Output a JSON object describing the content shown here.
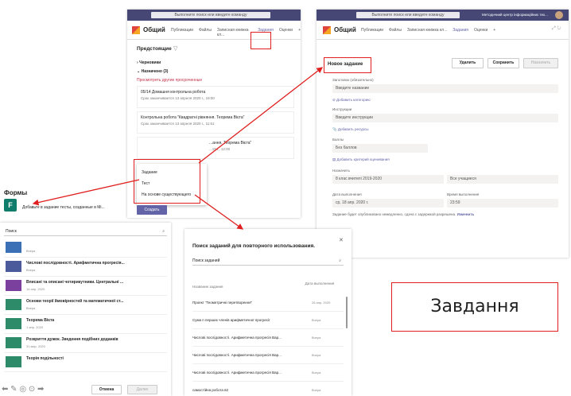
{
  "left_panel": {
    "search_placeholder": "Выполните поиск или введите команду",
    "channel": "Общий",
    "tabs": [
      "Публикации",
      "Файлы",
      "Записная книжка кл...",
      "Задания",
      "Оценки",
      "+"
    ],
    "upcoming": "Предстоящие",
    "drafts": "Черновики",
    "assigned": "Назначено (3)",
    "overdue_link": "Просмотреть другие просроченные",
    "cards": [
      {
        "title": "05/14 Домашня контрольна робота",
        "due": "Срок заканчивается 13 апреля 2020 г., 19:00"
      },
      {
        "title": "Контрольна робота \"Квадратні рівняння. Теорема Вієта\"",
        "due": "Срок заканчивается 13 апреля 2020 г., 11:51"
      },
      {
        "title": "...ання. Теорема Вієта\"",
        "due": "...19 г., 12:00"
      }
    ],
    "menu": [
      "Задание",
      "Тест",
      "На основе существующего"
    ],
    "create": "Создать"
  },
  "right_panel": {
    "search_placeholder": "Выполните поиск или введите команду",
    "org": "Методичний центр інформаційних тех...",
    "channel": "Общий",
    "tabs": [
      "Публикации",
      "Файлы",
      "Записная книжка кл...",
      "Задания",
      "Оценки",
      "+"
    ],
    "new_assignment": "Новое задание",
    "delete": "Удалить",
    "save": "Сохранить",
    "assign": "Назначить",
    "title_label": "Заголовок (обязательно)",
    "title_placeholder": "Введите название",
    "add_category": "Добавить категорию",
    "instructions_label": "Инструкции",
    "instructions_placeholder": "Введите инструкции",
    "add_resources": "Добавить ресурсы",
    "points_label": "Баллы",
    "points_value": "Без баллов",
    "add_rubric": "Добавить критерий оценивания",
    "assign_to_label": "Назначить",
    "class_value": "8 клас вчителі 2019-2020",
    "students_value": "Все учащиеся",
    "due_date_label": "Дата выполнения",
    "due_time_label": "Время выполнения",
    "due_date_value": "ср, 18 апр. 2020 г.",
    "due_time_value": "23:59",
    "note": "Задание будет опубликовано немедленно, сдача с задержкой разрешена.",
    "change_link": "Изменить"
  },
  "forms_panel": {
    "title": "Формы",
    "description": "Добавьте в задание тесты, созданные в Mi...",
    "search_placeholder": "Поиск",
    "items": [
      {
        "title": "",
        "date": "Вчера",
        "color": "#3b6fb6"
      },
      {
        "title": "Числові послідовності. Арифметична прогресія...",
        "date": "Вчера",
        "color": "#4a5a9a"
      },
      {
        "title": "Вписані та описані чотирикутники. Центральні ...",
        "date": "14 апр. 2020",
        "color": "#7b3f9e"
      },
      {
        "title": "Основи теорії ймовірностей та математичної ст...",
        "date": "Вчера",
        "color": "#2e8b6a"
      },
      {
        "title": "Теорема Вієта",
        "date": "1 апр. 2020",
        "color": "#2e8b6a"
      },
      {
        "title": "Розкриття дужок. Зведення подібних доданків",
        "date": "31 мар. 2020",
        "color": "#2e8b6a"
      },
      {
        "title": "Теорія подільності",
        "date": "",
        "color": "#2e8b6a"
      }
    ],
    "cancel": "Отмена",
    "next": "Далее"
  },
  "reuse_dialog": {
    "title": "Поиск заданий для повторного использования.",
    "search_placeholder": "Поиск заданий",
    "col_name": "Название задания",
    "col_date": "Дата выполнения",
    "rows": [
      {
        "name": "Проект \"Геометричні перетворення\"",
        "date": "26 апр. 2020"
      },
      {
        "name": "Сума n перших членів арифметичної прогресії",
        "date": "Вчера"
      },
      {
        "name": "Числові послідовності. Арифметична прогресія Вар...",
        "date": "Вчера"
      },
      {
        "name": "Числові послідовності. Арифметична прогресія Вар...",
        "date": "Вчера"
      },
      {
        "name": "Числові послідовності. Арифметична прогресія Вар...",
        "date": "Вчера"
      },
      {
        "name": "самостійна робота в2",
        "date": "Вчера"
      }
    ]
  },
  "caption": "Завдання",
  "colors": {
    "accent": "#6264a7",
    "header": "#464775",
    "highlight": "#e02020"
  }
}
